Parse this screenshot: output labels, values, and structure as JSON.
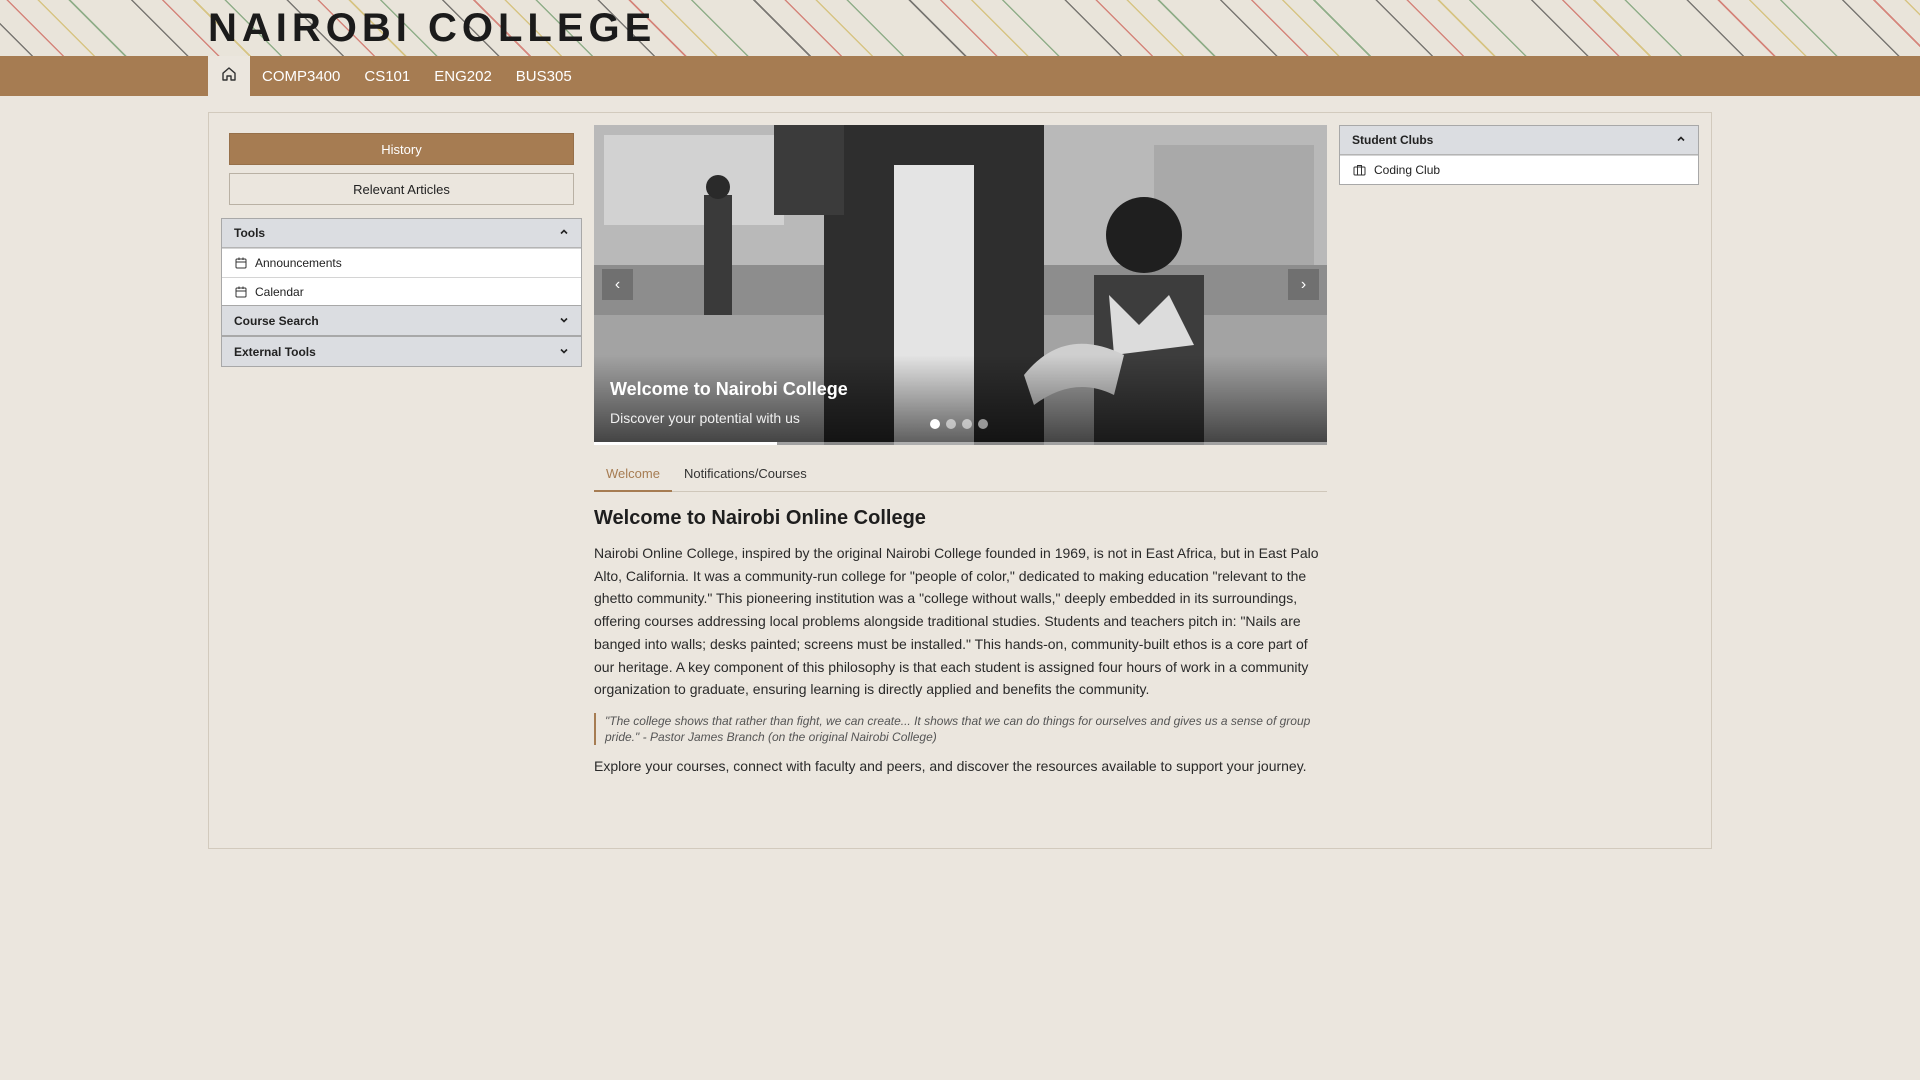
{
  "header": {
    "title": "NAIROBI COLLEGE"
  },
  "nav": {
    "home_icon": "home-icon",
    "links": [
      "COMP3400",
      "CS101",
      "ENG202",
      "BUS305"
    ]
  },
  "left": {
    "history_label": "History",
    "articles_label": "Relevant Articles",
    "tools": {
      "title": "Tools",
      "items": [
        {
          "label": "Announcements",
          "icon": "calendar-icon"
        },
        {
          "label": "Calendar",
          "icon": "calendar-icon"
        }
      ]
    },
    "course_search": {
      "title": "Course Search"
    },
    "external_tools": {
      "title": "External Tools"
    }
  },
  "carousel": {
    "title": "Welcome to Nairobi College",
    "subtitle": "Discover your potential with us",
    "slide_count": 4,
    "active_slide": 1,
    "progress": 0.25
  },
  "tabs": [
    "Welcome",
    "Notifications/Courses"
  ],
  "content": {
    "heading": "Welcome to Nairobi Online College",
    "paragraph": "Nairobi Online College, inspired by the original Nairobi College founded in 1969, is not in East Africa, but in East Palo Alto, California. It was a community-run college for \"people of color,\" dedicated to making education \"relevant to the ghetto community.\" This pioneering institution was a \"college without walls,\" deeply embedded in its surroundings, offering courses addressing local problems alongside traditional studies. Students and teachers pitch in: \"Nails are banged into walls; desks painted; screens must be installed.\" This hands-on, community-built ethos is a core part of our heritage. A key component of this philosophy is that each student is assigned four hours of work in a community organization to graduate, ensuring learning is directly applied and benefits the community.",
    "quote": "\"The college shows that rather than fight, we can create... It shows that we can do things for ourselves and gives us a sense of group pride.\" - Pastor James Branch (on the original Nairobi College)",
    "closing": "Explore your courses, connect with faculty and peers, and discover the resources available to support your journey."
  },
  "right": {
    "clubs": {
      "title": "Student Clubs",
      "items": [
        {
          "label": "Coding Club",
          "icon": "briefcase-icon"
        }
      ]
    }
  },
  "colors": {
    "accent": "#a67c52",
    "background": "#ebe6de",
    "panel_header": "#dbdde1"
  }
}
